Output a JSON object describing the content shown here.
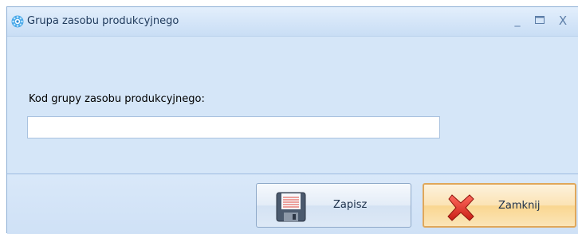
{
  "window": {
    "title": "Grupa zasobu produkcyjnego",
    "minimize_glyph": "_",
    "maximize_glyph": "□",
    "close_glyph": "X",
    "icon": "gear-circle-icon"
  },
  "form": {
    "code_label": "Kod grupy zasobu produkcyjnego:",
    "code_value": "",
    "code_placeholder": ""
  },
  "footer": {
    "save_label": "Zapisz",
    "save_icon": "floppy-disk-icon",
    "close_label": "Zamknij",
    "close_icon": "red-x-icon"
  },
  "colors": {
    "window_bg": "#d5e6f8",
    "title_text": "#1e395b",
    "highlight_border": "#e0a75a"
  }
}
